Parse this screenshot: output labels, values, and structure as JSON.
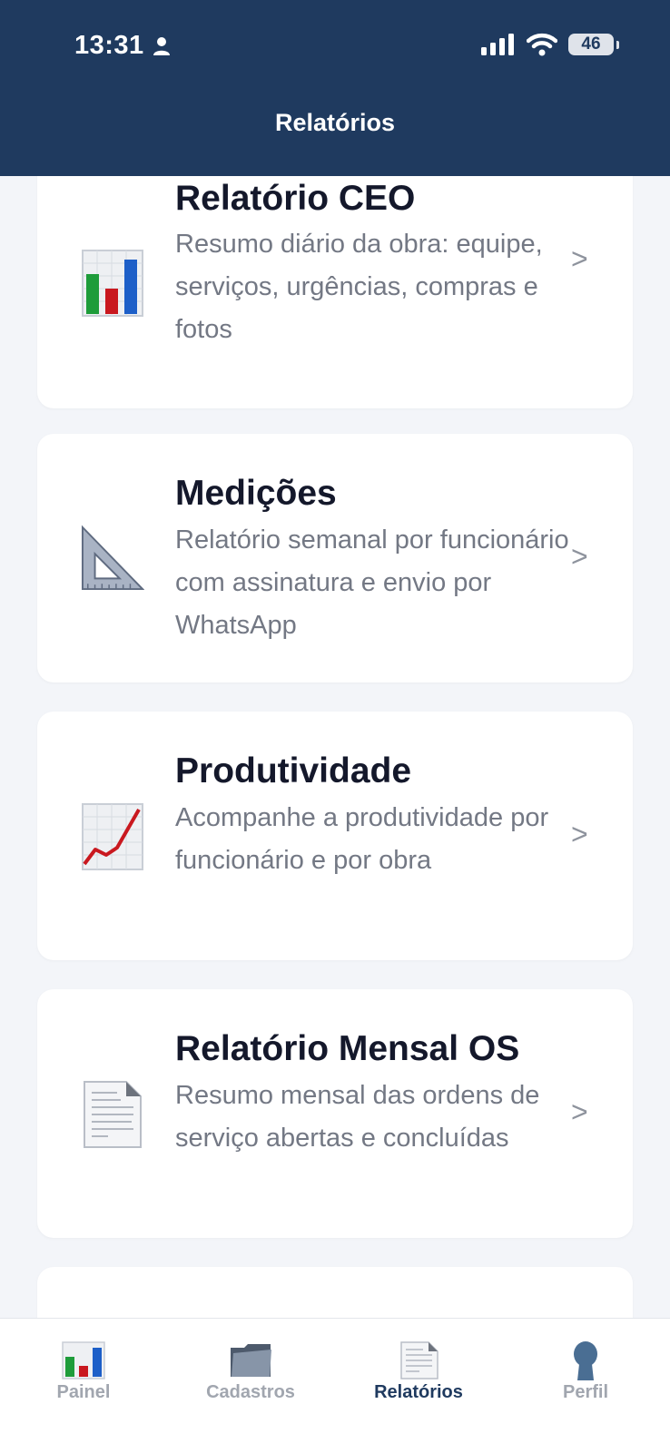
{
  "status": {
    "time": "13:31",
    "battery": "46"
  },
  "header": {
    "title": "Relatórios"
  },
  "reports": [
    {
      "title": "Relatório CEO",
      "description": "Resumo diário da obra: equipe, serviços, urgências, compras e fotos",
      "icon": "bar-chart-icon",
      "chevron": ">"
    },
    {
      "title": "Medições",
      "description": "Relatório semanal por funcionário com assinatura e envio por WhatsApp",
      "icon": "triangular-ruler-icon",
      "chevron": ">"
    },
    {
      "title": "Produtividade",
      "description": "Acompanhe a produtividade por funcionário e por obra",
      "icon": "trend-chart-icon",
      "chevron": ">"
    },
    {
      "title": "Relatório Mensal OS",
      "description": "Resumo mensal das ordens de serviço abertas e concluídas",
      "icon": "document-icon",
      "chevron": ">"
    }
  ],
  "tabs": [
    {
      "label": "Painel",
      "icon": "bar-chart-icon",
      "active": false
    },
    {
      "label": "Cadastros",
      "icon": "folder-icon",
      "active": false
    },
    {
      "label": "Relatórios",
      "icon": "document-icon",
      "active": true
    },
    {
      "label": "Perfil",
      "icon": "user-silhouette-icon",
      "active": false
    }
  ],
  "colors": {
    "header_bg": "#1f3a5f",
    "page_bg": "#f3f5f9",
    "active_tab": "#1f3a5f",
    "inactive_tab": "#a1a6af"
  }
}
